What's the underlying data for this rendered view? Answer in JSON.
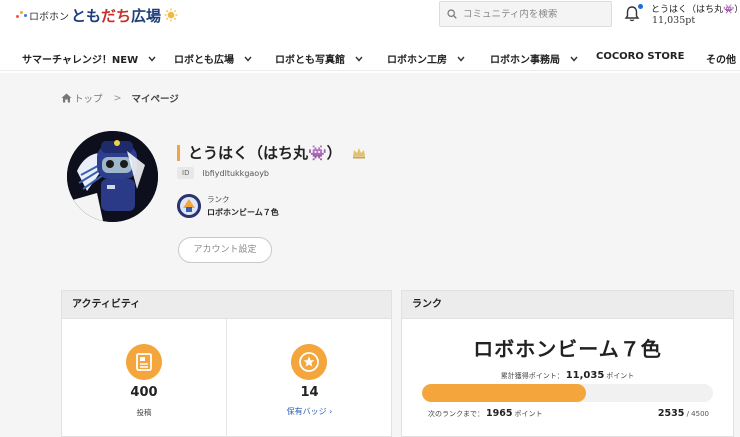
{
  "header": {
    "logo_small": "ロボホン",
    "logo_part1": "とも",
    "logo_part2": "だち",
    "logo_part3": "広場",
    "search_placeholder": "コミュニティ内を検索",
    "user_name": "とうはく（はち丸👾）",
    "user_points": "11,035pt"
  },
  "nav": {
    "items": [
      {
        "label": "サマーチャレンジ！NEW"
      },
      {
        "label": "ロボとも広場"
      },
      {
        "label": "ロボとも写真館"
      },
      {
        "label": "ロボホン工房"
      },
      {
        "label": "ロボホン事務局"
      },
      {
        "label": "COCORO STORE"
      },
      {
        "label": "その他"
      }
    ]
  },
  "breadcrumb": {
    "home": "トップ",
    "separator": ">",
    "current": "マイページ"
  },
  "profile": {
    "name": "とうはく（はち丸👾）",
    "id_label": "ID",
    "id_value": "lbfiydltukkgaoyb",
    "rank_label": "ランク",
    "rank_value": "ロボホンビーム７色",
    "account_button": "アカウント設定"
  },
  "activity": {
    "title": "アクティビティ",
    "posts_count": "400",
    "posts_label": "投稿",
    "badges_count": "14",
    "badges_link": "保有バッジ ›"
  },
  "rank": {
    "title": "ランク",
    "rank_name": "ロボホンビーム７色",
    "total_label": "累計獲得ポイント：",
    "total_value": "11,035",
    "points_unit": "ポイント",
    "next_label": "次のランクまで：",
    "next_value": "1965",
    "current": "2535",
    "target": " / 4500",
    "progress": 0.5633
  },
  "colors": {
    "accent": "#f4a63c",
    "link": "#2a5db0",
    "notification": "#1d6be0"
  },
  "icons": {
    "search": "search-icon",
    "bell": "bell-icon",
    "home": "home-icon",
    "post": "document-icon",
    "badge": "star-badge-icon"
  }
}
